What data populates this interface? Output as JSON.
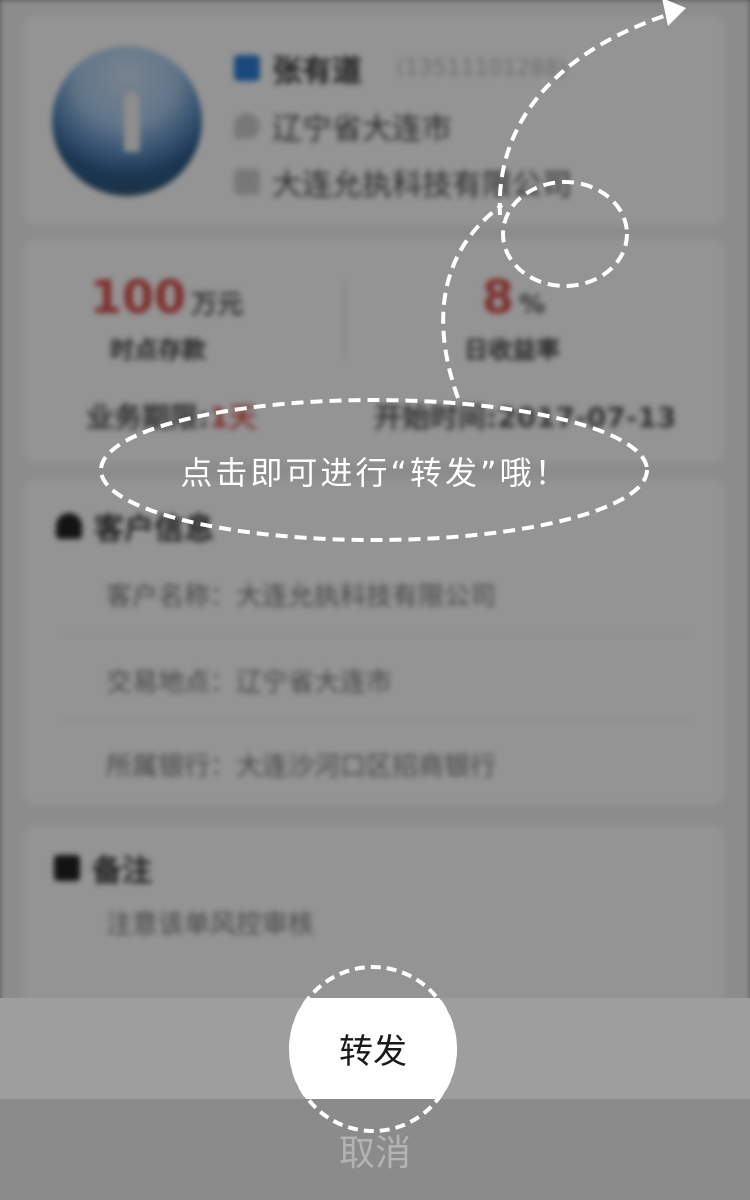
{
  "profile": {
    "name": "张有道",
    "phone": "(13511101288)",
    "location": "辽宁省大连市",
    "company": "大连允执科技有限公司"
  },
  "stats": {
    "amount_value": "100",
    "amount_unit": "万元",
    "amount_label": "时点存款",
    "rate_value": "8",
    "rate_unit": "%",
    "rate_label": "日收益率",
    "period_prefix": "业务期限:",
    "period_value": "1天",
    "start_prefix": "开始时间:",
    "start_value": "2017-07-13"
  },
  "client_info": {
    "title": "客户信息",
    "fields": [
      "客户名称：大连允执科技有限公司",
      "交易地点：辽宁省大连市",
      "所属银行：大连沙河口区招商银行"
    ]
  },
  "note": {
    "title": "备注",
    "content": "注意该单风控审核"
  },
  "guide": {
    "tip": "点击即可进行“转发”哦！"
  },
  "action_sheet": {
    "forward_label": "转发",
    "cancel_label": "取消"
  },
  "colors": {
    "accent_red": "#d9534f",
    "user_icon": "#2f7fd6"
  }
}
